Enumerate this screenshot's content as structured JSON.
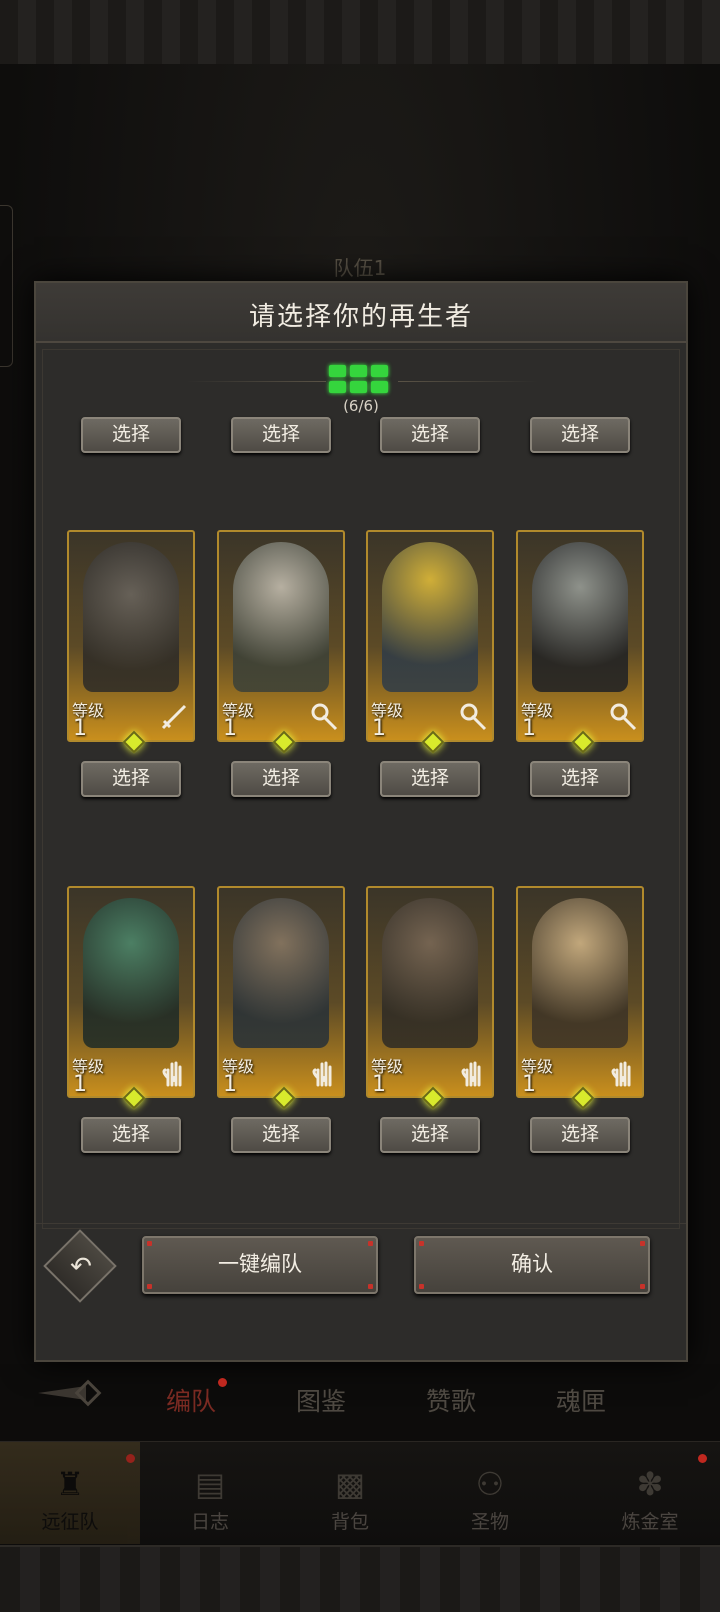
{
  "background": {
    "team_label": "队伍1"
  },
  "modal": {
    "title": "请选择你的再生者",
    "count_text": "(6/6)",
    "select_label": "选择",
    "level_label": "等级"
  },
  "heroes": [
    {
      "level": "1",
      "class_icon": "sword-icon"
    },
    {
      "level": "1",
      "class_icon": "staff-icon"
    },
    {
      "level": "1",
      "class_icon": "staff-icon"
    },
    {
      "level": "1",
      "class_icon": "staff-icon"
    },
    {
      "level": "1",
      "class_icon": "hand-icon"
    },
    {
      "level": "1",
      "class_icon": "hand-icon"
    },
    {
      "level": "1",
      "class_icon": "hand-icon"
    },
    {
      "level": "1",
      "class_icon": "hand-icon"
    }
  ],
  "footer": {
    "auto_team_label": "一键编队",
    "confirm_label": "确认"
  },
  "subtabs": [
    "编队",
    "图鉴",
    "赞歌",
    "魂匣"
  ],
  "nav": [
    "远征队",
    "日志",
    "背包",
    "圣物",
    "炼金室"
  ],
  "colors": {
    "accent_gold": "#b18a2c",
    "count_green": "#35d53d",
    "alert_red": "#c0281f"
  }
}
